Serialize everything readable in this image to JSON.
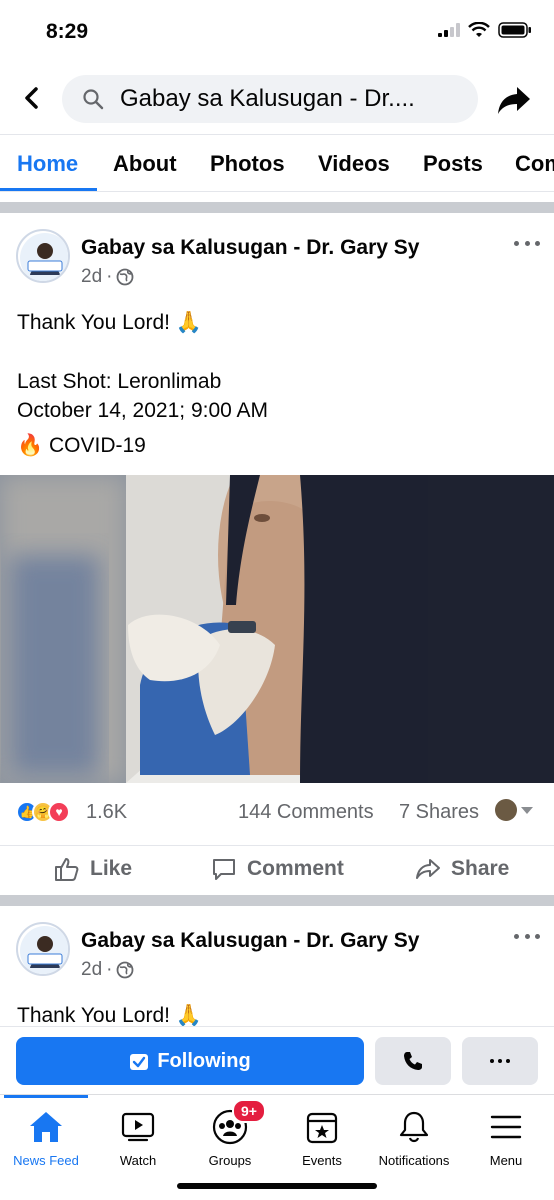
{
  "status_bar": {
    "time": "8:29"
  },
  "header": {
    "search_text": "Gabay sa Kalusugan - Dr...."
  },
  "tabs": [
    {
      "label": "Home",
      "active": true
    },
    {
      "label": "About"
    },
    {
      "label": "Photos"
    },
    {
      "label": "Videos"
    },
    {
      "label": "Posts"
    },
    {
      "label": "Com"
    }
  ],
  "posts": [
    {
      "author": "Gabay sa Kalusugan - Dr. Gary Sy",
      "time": "2d",
      "text_line1": "Thank You Lord! 🙏",
      "text_line2": "Last Shot: Leronlimab",
      "text_line3": "October 14, 2021; 9:00 AM",
      "text_line4": "🔥 COVID-19",
      "reaction_count": "1.6K",
      "comments": "144 Comments",
      "shares": "7 Shares",
      "actions": {
        "like": "Like",
        "comment": "Comment",
        "share": "Share"
      }
    },
    {
      "author": "Gabay sa Kalusugan - Dr. Gary Sy",
      "time": "2d",
      "text_line1": "Thank You Lord! 🙏"
    }
  ],
  "bottom_actions": {
    "following_label": "Following"
  },
  "tabbar": [
    {
      "label": "News Feed",
      "icon": "home-icon",
      "active": true
    },
    {
      "label": "Watch",
      "icon": "watch-icon"
    },
    {
      "label": "Groups",
      "icon": "groups-icon",
      "badge": "9+"
    },
    {
      "label": "Events",
      "icon": "events-icon"
    },
    {
      "label": "Notifications",
      "icon": "bell-icon"
    },
    {
      "label": "Menu",
      "icon": "menu-icon"
    }
  ],
  "colors": {
    "accent": "#1877f2",
    "badge": "#e41e3f",
    "separator": "#c9ccd1"
  }
}
